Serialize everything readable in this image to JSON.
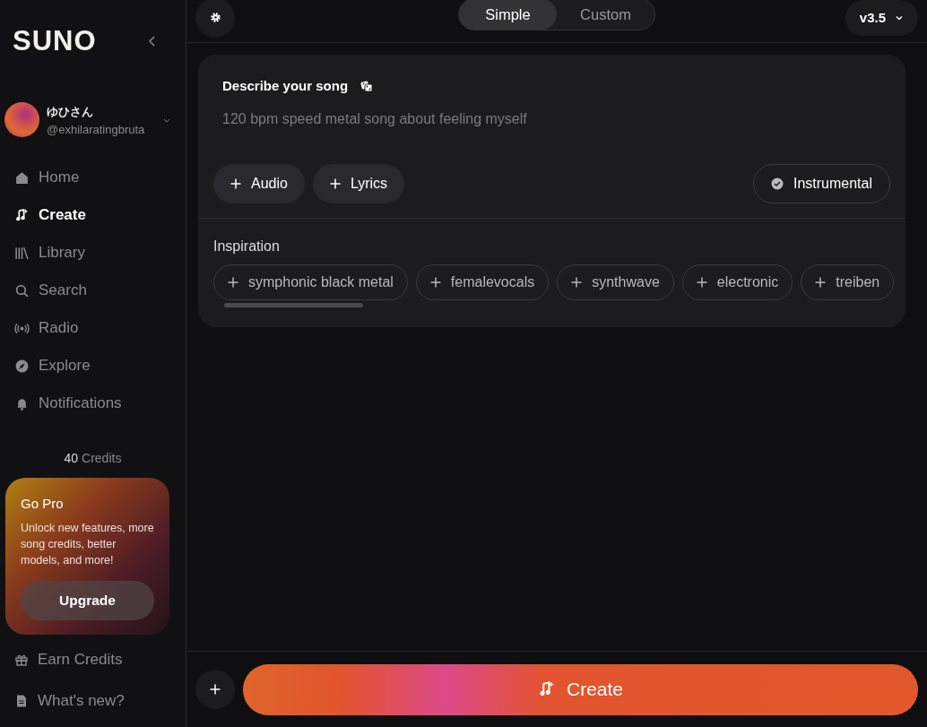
{
  "sidebar": {
    "logo": "SUNO",
    "user": {
      "name": "ゆひさん",
      "handle": "@exhilaratingbruta"
    },
    "nav": [
      {
        "label": "Home",
        "selected": false
      },
      {
        "label": "Create",
        "selected": true
      },
      {
        "label": "Library",
        "selected": false
      },
      {
        "label": "Search",
        "selected": false
      },
      {
        "label": "Radio",
        "selected": false
      },
      {
        "label": "Explore",
        "selected": false
      },
      {
        "label": "Notifications",
        "selected": false
      }
    ],
    "credits": {
      "count": "40",
      "label": "Credits"
    },
    "promo": {
      "title": "Go Pro",
      "text": "Unlock new features, more song credits, better models, and more!",
      "button": "Upgrade"
    },
    "footer": [
      {
        "label": "Earn Credits"
      },
      {
        "label": "What's new?"
      }
    ]
  },
  "modes": [
    {
      "label": "Simple",
      "selected": true
    },
    {
      "label": "Custom",
      "selected": false
    }
  ],
  "version": "v3.5",
  "prompt": {
    "label": "Describe your song",
    "placeholder": "120 bpm speed metal song about feeling myself"
  },
  "add_buttons": [
    "Audio",
    "Lyrics"
  ],
  "instrumental": {
    "label": "Instrumental",
    "checked": true
  },
  "inspiration": {
    "label": "Inspiration",
    "tags": [
      "symphonic black metal",
      "femalevocals",
      "synthwave",
      "electronic",
      "treiben"
    ]
  },
  "create_button": "Create"
}
